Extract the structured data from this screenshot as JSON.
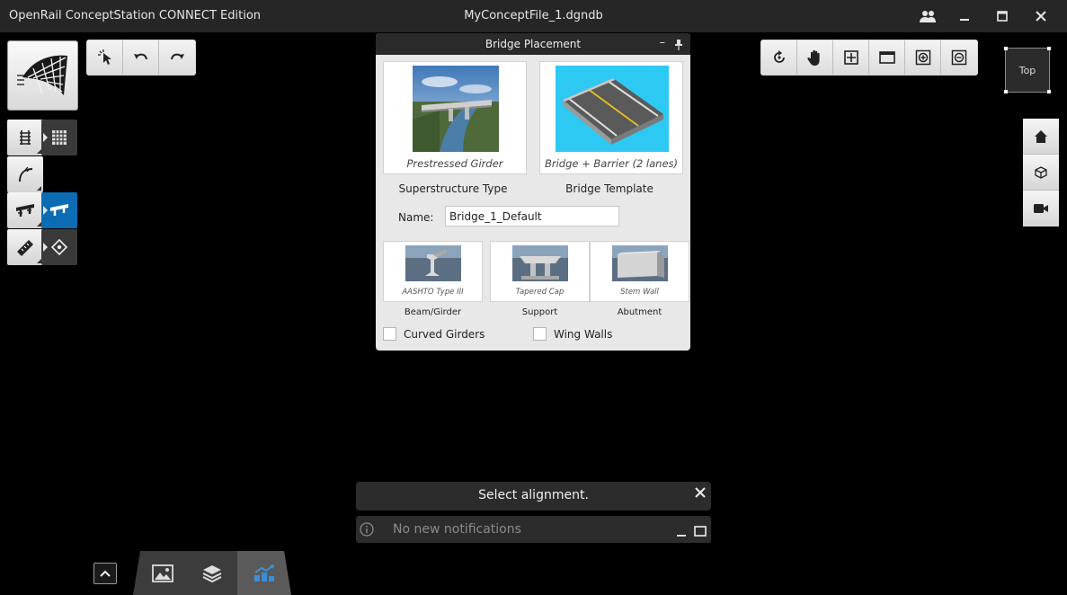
{
  "titlebar": {
    "app_title": "OpenRail ConceptStation CONNECT Edition",
    "file_title": "MyConceptFile_1.dgndb",
    "buttons": [
      "users-icon",
      "minimize-icon",
      "maximize-icon",
      "close-icon"
    ]
  },
  "toolbars": {
    "edit": [
      "select-icon",
      "undo-icon",
      "redo-icon"
    ],
    "view": [
      "rotate-icon",
      "pan-hand-icon",
      "fit-view-icon",
      "window-area-icon",
      "zoom-in-icon",
      "zoom-out-icon"
    ]
  },
  "view_cube": {
    "label": "Top"
  },
  "right_tools": [
    "home-icon",
    "cube-view-icon",
    "camera-icon"
  ],
  "dialog": {
    "title": "Bridge Placement",
    "superstructure": {
      "caption": "Prestressed Girder",
      "label": "Superstructure Type"
    },
    "template": {
      "caption": "Bridge + Barrier (2 lanes)",
      "label": "Bridge Template"
    },
    "name_label": "Name:",
    "name_value": "Bridge_1_Default",
    "components": [
      {
        "caption": "AASHTO Type III",
        "label": "Beam/Girder"
      },
      {
        "caption": "Tapered Cap",
        "label": "Support"
      },
      {
        "caption": "Stem Wall",
        "label": "Abutment"
      }
    ],
    "checkboxes": [
      {
        "label": "Curved Girders",
        "checked": false
      },
      {
        "label": "Wing Walls",
        "checked": false
      }
    ]
  },
  "prompt": {
    "text": "Select alignment."
  },
  "notifications": {
    "text": "No new notifications"
  },
  "colors": {
    "accent": "#0b6cb4",
    "titlebar": "#262626",
    "background": "#000000"
  }
}
